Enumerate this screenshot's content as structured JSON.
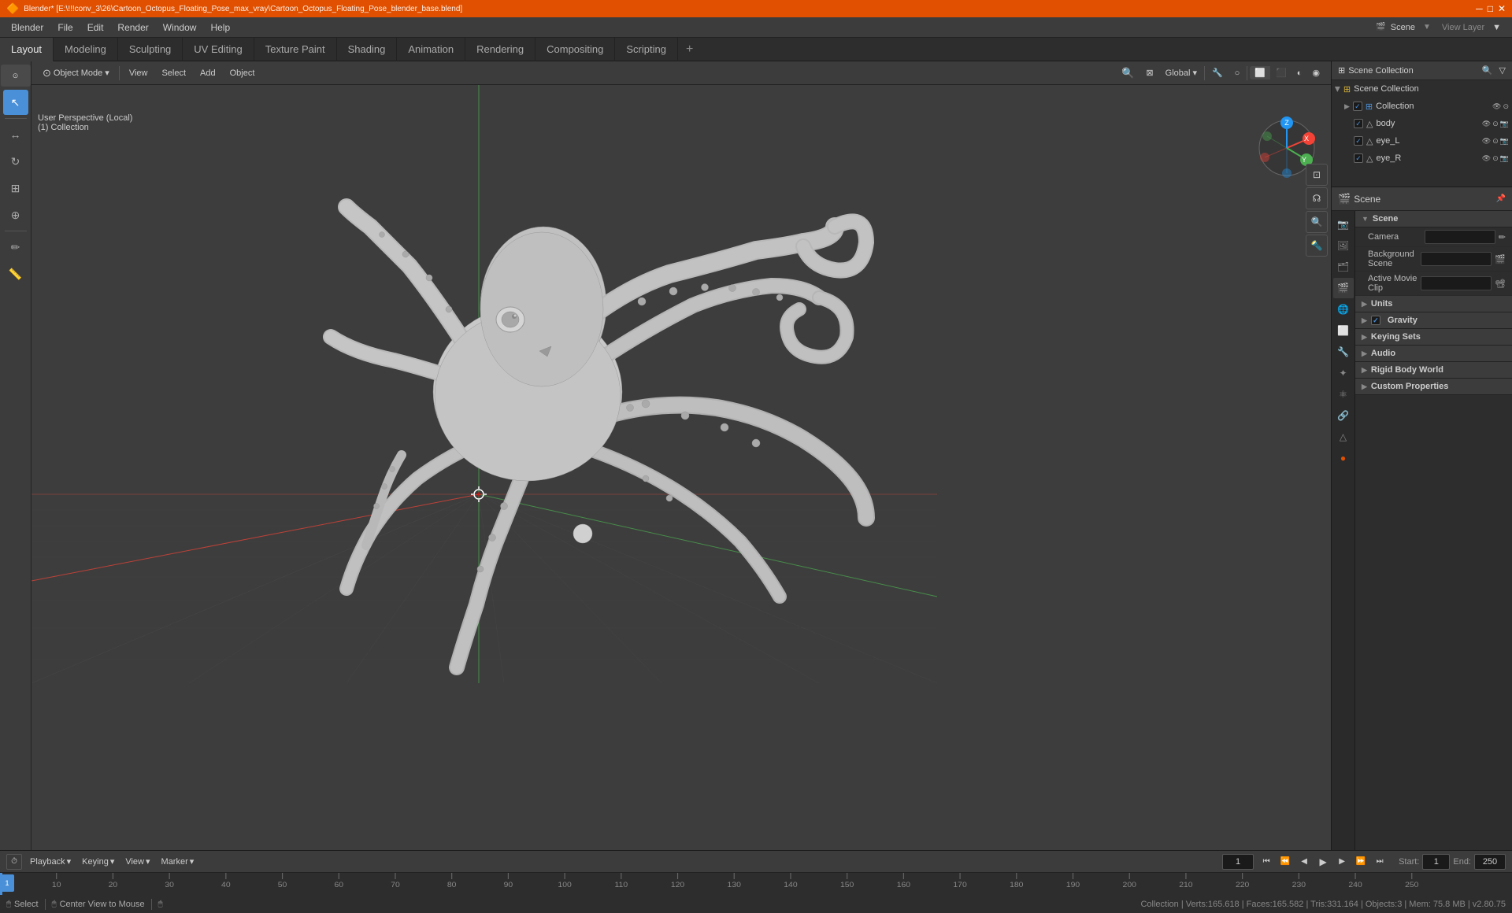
{
  "titlebar": {
    "title": "Blender* [E:\\!!!conv_3\\26\\Cartoon_Octopus_Floating_Pose_max_vray\\Cartoon_Octopus_Floating_Pose_blender_base.blend]",
    "logo": "●"
  },
  "menubar": {
    "items": [
      "Blender",
      "File",
      "Edit",
      "Render",
      "Window",
      "Help"
    ]
  },
  "workspace_tabs": {
    "tabs": [
      "Layout",
      "Modeling",
      "Sculpting",
      "UV Editing",
      "Texture Paint",
      "Shading",
      "Animation",
      "Rendering",
      "Compositing",
      "Scripting"
    ],
    "active": "Layout",
    "add_label": "+"
  },
  "viewport_header": {
    "mode_label": "Object Mode",
    "view_label": "View",
    "select_label": "Select",
    "add_label": "Add",
    "object_label": "Object",
    "transform_global": "Global",
    "snap_icon": "🔧"
  },
  "viewport": {
    "perspective_label": "User Perspective (Local)",
    "collection_label": "(1) Collection"
  },
  "outliner": {
    "title": "Scene Collection",
    "items": [
      {
        "name": "Collection",
        "level": 1,
        "type": "collection",
        "checked": true
      },
      {
        "name": "body",
        "level": 2,
        "type": "object",
        "checked": true
      },
      {
        "name": "eye_L",
        "level": 2,
        "type": "object",
        "checked": true
      },
      {
        "name": "eye_R",
        "level": 2,
        "type": "object",
        "checked": true
      }
    ]
  },
  "properties_panel": {
    "header_title": "Scene",
    "scene_name": "Scene",
    "sections": {
      "scene": {
        "label": "Scene",
        "camera_label": "Camera",
        "background_scene_label": "Background Scene",
        "active_movie_clip_label": "Active Movie Clip"
      },
      "units": {
        "label": "Units",
        "collapsed": true
      },
      "gravity": {
        "label": "Gravity",
        "checked": true
      },
      "keying_sets": {
        "label": "Keying Sets",
        "collapsed": true
      },
      "audio": {
        "label": "Audio",
        "collapsed": true
      },
      "rigid_body_world": {
        "label": "Rigid Body World",
        "collapsed": true
      },
      "custom_properties": {
        "label": "Custom Properties",
        "collapsed": true
      }
    }
  },
  "timeline": {
    "playback_label": "Playback",
    "keying_label": "Keying",
    "view_label": "View",
    "marker_label": "Marker",
    "start_label": "Start:",
    "start_value": "1",
    "end_label": "End:",
    "end_value": "250",
    "current_frame": "1",
    "frame_marks": [
      "1",
      "10",
      "20",
      "30",
      "40",
      "50",
      "60",
      "70",
      "80",
      "90",
      "100",
      "110",
      "120",
      "130",
      "140",
      "150",
      "160",
      "170",
      "180",
      "190",
      "200",
      "210",
      "220",
      "230",
      "240",
      "250"
    ]
  },
  "statusbar": {
    "select_label": "Select",
    "center_view_label": "Center View to Mouse",
    "stats": "Collection | Verts:165.618 | Faces:165.582 | Tris:331.164 | Objects:3 | Mem: 75.8 MB | v2.80.75"
  },
  "icons": {
    "chevron_right": "▶",
    "chevron_down": "▼",
    "camera": "📷",
    "scene": "🎬",
    "check": "✓",
    "play": "▶",
    "pause": "⏸",
    "skip_start": "⏮",
    "skip_end": "⏭",
    "prev_frame": "◀",
    "next_frame": "▶"
  },
  "colors": {
    "accent_blue": "#4a90d9",
    "title_bar": "#e05000",
    "active_tab_bg": "#3c3c3c",
    "panel_bg": "#2d2d2d",
    "section_bg": "#3c3c3c",
    "border": "#1a1a1a",
    "gravity_checked": true
  }
}
